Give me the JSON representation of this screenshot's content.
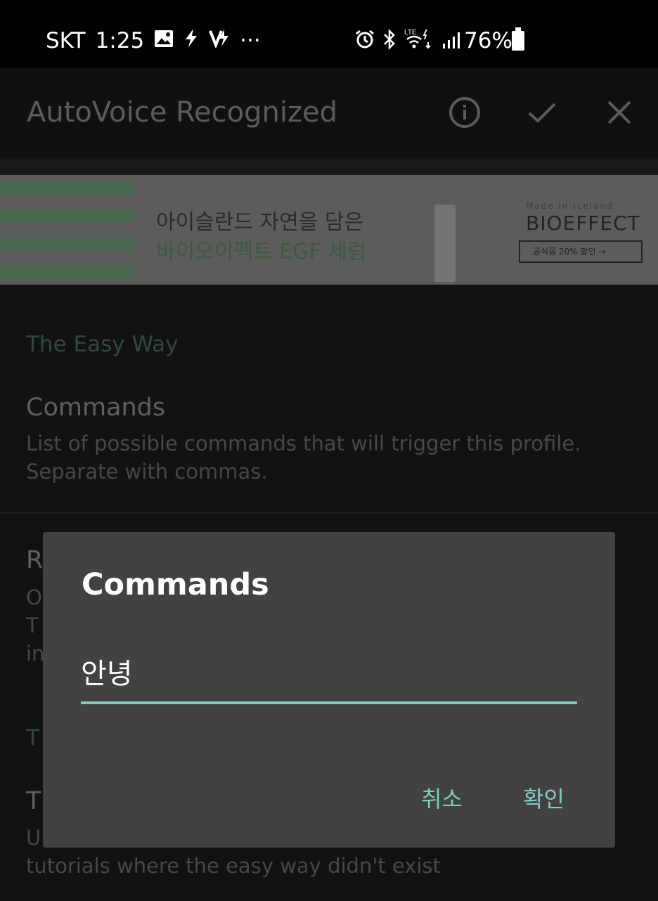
{
  "status_bar": {
    "carrier": "SKT",
    "time": "1:25",
    "more": "···",
    "lte": "LTE",
    "battery": "76%"
  },
  "app_bar": {
    "title": "AutoVoice Recognized"
  },
  "ad": {
    "line1": "아이슬란드 자연을 담은",
    "line2": "바이오이펙트 EGF 세럼",
    "made": "Made in Iceland",
    "brand": "BIOEFFECT",
    "cta": "공식몰 20% 할인"
  },
  "content": {
    "section_easy": "The Easy Way",
    "commands_title": "Commands",
    "commands_summary_1": "List of possible commands that will trigger this profile.",
    "commands_summary_2": "Separate with commas.",
    "partial_r": "R",
    "partial_o": "O",
    "partial_t1": "T",
    "partial_in": "in",
    "partial_t2": "T",
    "partial_t3": "T",
    "partial_u": "U",
    "tutorials": "tutorials where the easy way didn't exist"
  },
  "dialog": {
    "title": "Commands",
    "input_value": "안녕",
    "cancel_label": "취소",
    "ok_label": "확인"
  },
  "colors": {
    "accent": "#80cbc4",
    "dialog_bg": "#424242"
  }
}
